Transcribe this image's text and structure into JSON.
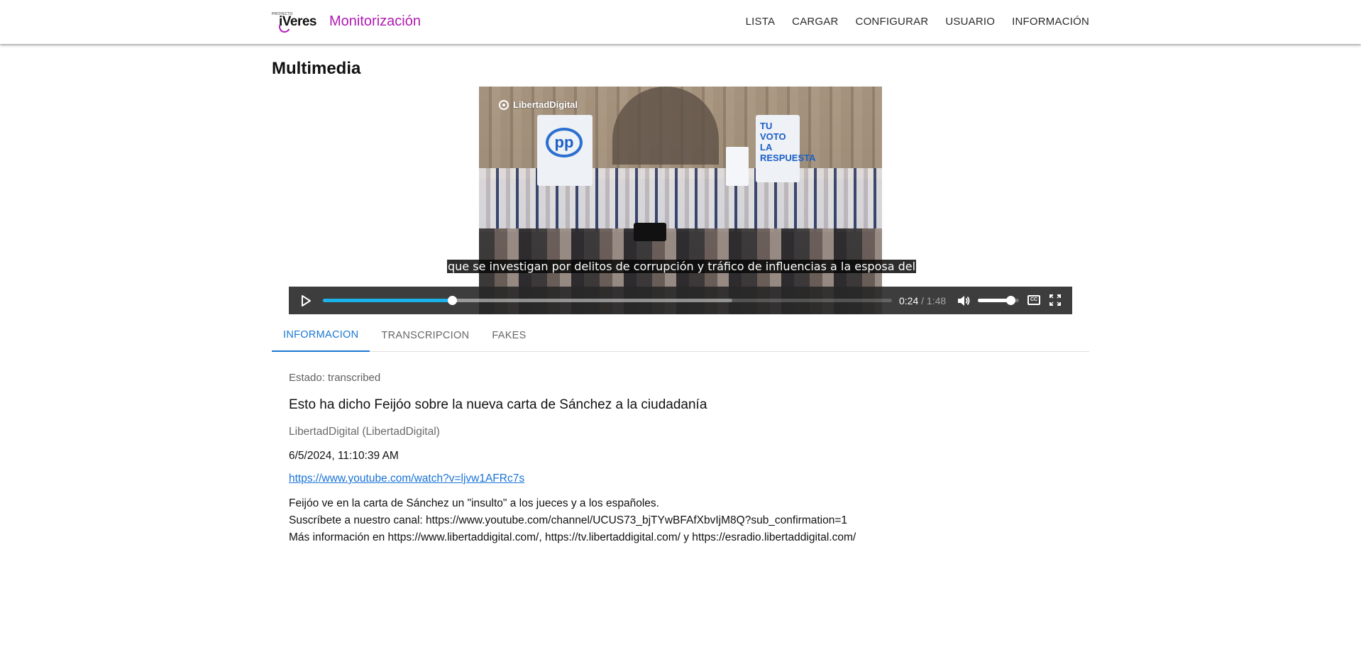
{
  "header": {
    "logo_small": "PROYECTO",
    "logo_word": "iVeres",
    "app_title": "Monitorización",
    "nav": [
      "LISTA",
      "CARGAR",
      "CONFIGURAR",
      "USUARIO",
      "INFORMACIÓN"
    ]
  },
  "page": {
    "title": "Multimedia"
  },
  "video": {
    "watermark": "LibertadDigital",
    "board_logo": "pp",
    "board_slogan": "TU VOTO LA RESPUESTA",
    "caption": "que se investigan por delitos de corrupción y tráfico de influencias a la esposa del",
    "current_time": "0:24",
    "separator": " / ",
    "duration": "1:48",
    "progress_fraction": 0.227,
    "buffered_fraction": 0.72,
    "volume_fraction": 0.8,
    "cc_label": "CC",
    "accent_color": "#1ab2e8"
  },
  "tabs": [
    {
      "label": "INFORMACION",
      "active": true
    },
    {
      "label": "TRANSCRIPCION",
      "active": false
    },
    {
      "label": "FAKES",
      "active": false
    }
  ],
  "info": {
    "status": "Estado: transcribed",
    "title": "Esto ha dicho Feijóo sobre la nueva carta de Sánchez a la ciudadanía",
    "channel": "LibertadDigital (LibertadDigital)",
    "date": "6/5/2024, 11:10:39 AM",
    "url": "https://www.youtube.com/watch?v=ljvw1AFRc7s",
    "description": [
      "Feijóo ve en la carta de Sánchez un \"insulto\" a los jueces y a los españoles.",
      "Suscríbete a nuestro canal: https://www.youtube.com/channel/UCUS73_bjTYwBFAfXbvIjM8Q?sub_confirmation=1",
      "Más información en https://www.libertaddigital.com/, https://tv.libertaddigital.com/ y https://esradio.libertaddigital.com/"
    ]
  },
  "colors": {
    "brand": "#b01bb3",
    "tab_active": "#1976d2",
    "link": "#1a73d9"
  }
}
